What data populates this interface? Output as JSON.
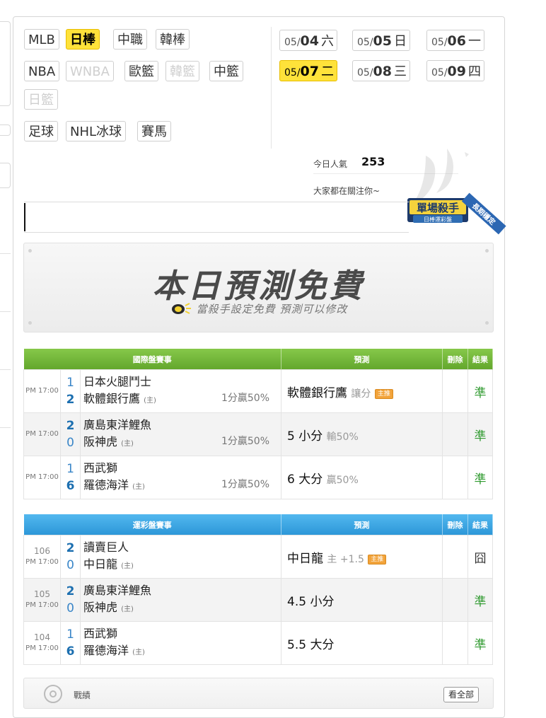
{
  "leagues": [
    {
      "label": "MLB",
      "state": "normal"
    },
    {
      "label": "日棒",
      "state": "active"
    },
    {
      "label": "中職",
      "state": "normal"
    },
    {
      "label": "韓棒",
      "state": "normal"
    },
    {
      "label": "NBA",
      "state": "normal"
    },
    {
      "label": "WNBA",
      "state": "disabled"
    },
    {
      "label": "歐籃",
      "state": "normal"
    },
    {
      "label": "韓籃",
      "state": "disabled"
    },
    {
      "label": "中籃",
      "state": "normal"
    },
    {
      "label": "日籃",
      "state": "disabled"
    },
    {
      "label": "足球",
      "state": "normal"
    },
    {
      "label": "NHL冰球",
      "state": "normal"
    },
    {
      "label": "賽馬",
      "state": "normal"
    }
  ],
  "dates": [
    {
      "md": "05/",
      "dd": "04",
      "wd": "六",
      "active": false
    },
    {
      "md": "05/",
      "dd": "05",
      "wd": "日",
      "active": false
    },
    {
      "md": "05/",
      "dd": "06",
      "wd": "一",
      "active": false
    },
    {
      "md": "05/",
      "dd": "07",
      "wd": "二",
      "active": true
    },
    {
      "md": "05/",
      "dd": "08",
      "wd": "三",
      "active": false
    },
    {
      "md": "05/",
      "dd": "09",
      "wd": "四",
      "active": false
    }
  ],
  "popularity": {
    "label": "今日人氣",
    "value": "253",
    "follow": "大家都在關注你~"
  },
  "badge": {
    "title": "單場殺手",
    "subtitle": "日棒運彩盤",
    "ribbon": "長期穩定"
  },
  "promo": {
    "title": "本日預測免費",
    "subtitle": "當殺手設定免費 預測可以修改"
  },
  "intl_table": {
    "headers": {
      "event": "國際盤賽事",
      "prediction": "預測",
      "delete": "刪除",
      "result": "結果"
    },
    "rows": [
      {
        "time": "PM 17:00",
        "s1": "1",
        "s2": "2",
        "t1": "日本火腿鬥士",
        "t2": "軟體銀行鷹",
        "home": "(主)",
        "handicap": "1分贏50%",
        "pick": "軟體銀行鷹",
        "pick_sub": "讓分",
        "pick_badge": "主推",
        "result": "準"
      },
      {
        "time": "PM 17:00",
        "s1": "2",
        "s2": "0",
        "t1": "廣島東洋鯉魚",
        "t2": "阪神虎",
        "home": "(主)",
        "handicap": "1分贏50%",
        "pick": "5 小分",
        "pick_sub": "輸50%",
        "pick_badge": "",
        "result": "準"
      },
      {
        "time": "PM 17:00",
        "s1": "1",
        "s2": "6",
        "t1": "西武獅",
        "t2": "羅德海洋",
        "home": "(主)",
        "handicap": "1分贏50%",
        "pick": "6 大分",
        "pick_sub": "贏50%",
        "pick_badge": "",
        "result": "準"
      }
    ]
  },
  "lottery_table": {
    "headers": {
      "event": "運彩盤賽事",
      "prediction": "預測",
      "delete": "刪除",
      "result": "結果"
    },
    "rows": [
      {
        "num": "106",
        "time": "PM 17:00",
        "s1": "2",
        "s2": "0",
        "t1": "讀賣巨人",
        "t2": "中日龍",
        "home": "(主)",
        "pick": "中日龍",
        "pick_sub": "主 +1.5",
        "pick_badge": "主推",
        "result": "囧"
      },
      {
        "num": "105",
        "time": "PM 17:00",
        "s1": "2",
        "s2": "0",
        "t1": "廣島東洋鯉魚",
        "t2": "阪神虎",
        "home": "(主)",
        "pick": "4.5 小分",
        "pick_sub": "",
        "pick_badge": "",
        "result": "準"
      },
      {
        "num": "104",
        "time": "PM 17:00",
        "s1": "1",
        "s2": "6",
        "t1": "西武獅",
        "t2": "羅德海洋",
        "home": "(主)",
        "pick": "5.5 大分",
        "pick_sub": "",
        "pick_badge": "",
        "result": "準"
      }
    ]
  },
  "record": {
    "label": "戰績",
    "button": "看全部"
  }
}
